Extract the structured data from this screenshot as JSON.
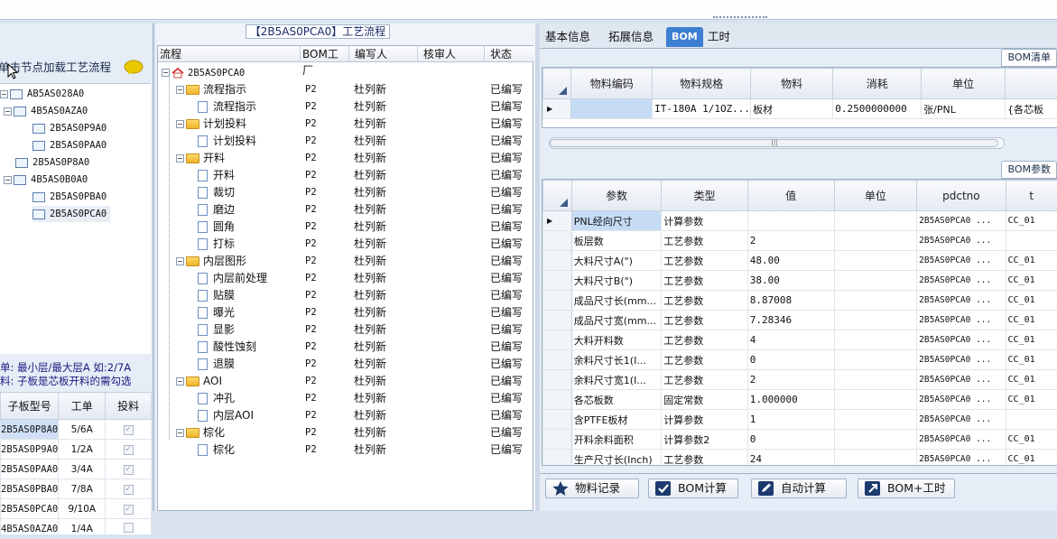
{
  "left": {
    "title": "单击节点加载工艺流程",
    "tree": [
      {
        "label": "AB5AS028A0",
        "level": 0,
        "expanded": true
      },
      {
        "label": "4B5AS0AZA0",
        "level": 1,
        "expanded": true
      },
      {
        "label": "2B5AS0P9A0",
        "level": 2
      },
      {
        "label": "2B5AS0PAA0",
        "level": 2
      },
      {
        "label": "2B5AS0P8A0",
        "level": 1
      },
      {
        "label": "4B5AS0B0A0",
        "level": 1,
        "expanded": true
      },
      {
        "label": "2B5AS0PBA0",
        "level": 2
      },
      {
        "label": "2B5AS0PCA0",
        "level": 2,
        "selected": true
      }
    ],
    "note_line1": "单: 最小层/最大层A 如:2/7A",
    "note_line2": "料: 子板是芯板开料的需勾选",
    "grid_headers": [
      "子板型号",
      "工单",
      "投料"
    ],
    "grid_rows": [
      {
        "model": "2B5AS0P8A0",
        "order": "5/6A",
        "checked": true,
        "selected": true
      },
      {
        "model": "2B5AS0P9A0",
        "order": "1/2A",
        "checked": true
      },
      {
        "model": "2B5AS0PAA0",
        "order": "3/4A",
        "checked": true
      },
      {
        "model": "2B5AS0PBA0",
        "order": "7/8A",
        "checked": true
      },
      {
        "model": "2B5AS0PCA0",
        "order": "9/10A",
        "checked": true
      },
      {
        "model": "4B5AS0AZA0",
        "order": "1/4A",
        "checked": false
      }
    ]
  },
  "middle": {
    "title": "【2B5AS0PCA0】工艺流程",
    "headers": [
      "流程",
      "BOM工厂",
      "编写人",
      "核审人",
      "状态"
    ],
    "root": "2B5AS0PCA0",
    "rows": [
      {
        "name": "流程指示",
        "type": "folder",
        "bom": "P2",
        "writer": "杜列新",
        "status": "已编写"
      },
      {
        "name": "流程指示",
        "type": "doc",
        "bom": "P2",
        "writer": "杜列新",
        "status": "已编写"
      },
      {
        "name": "计划投料",
        "type": "folder",
        "bom": "P2",
        "writer": "杜列新",
        "status": "已编写"
      },
      {
        "name": "计划投料",
        "type": "doc",
        "bom": "P2",
        "writer": "杜列新",
        "status": "已编写"
      },
      {
        "name": "开料",
        "type": "folder",
        "bom": "P2",
        "writer": "杜列新",
        "status": "已编写"
      },
      {
        "name": "开料",
        "type": "doc",
        "bom": "P2",
        "writer": "杜列新",
        "status": "已编写"
      },
      {
        "name": "裁切",
        "type": "doc",
        "bom": "P2",
        "writer": "杜列新",
        "status": "已编写"
      },
      {
        "name": "磨边",
        "type": "doc",
        "bom": "P2",
        "writer": "杜列新",
        "status": "已编写"
      },
      {
        "name": "圆角",
        "type": "doc",
        "bom": "P2",
        "writer": "杜列新",
        "status": "已编写"
      },
      {
        "name": "打标",
        "type": "doc",
        "bom": "P2",
        "writer": "杜列新",
        "status": "已编写"
      },
      {
        "name": "内层图形",
        "type": "folder",
        "bom": "P2",
        "writer": "杜列新",
        "status": "已编写"
      },
      {
        "name": "内层前处理",
        "type": "doc",
        "bom": "P2",
        "writer": "杜列新",
        "status": "已编写"
      },
      {
        "name": "贴膜",
        "type": "doc",
        "bom": "P2",
        "writer": "杜列新",
        "status": "已编写"
      },
      {
        "name": "曝光",
        "type": "doc",
        "bom": "P2",
        "writer": "杜列新",
        "status": "已编写"
      },
      {
        "name": "显影",
        "type": "doc",
        "bom": "P2",
        "writer": "杜列新",
        "status": "已编写"
      },
      {
        "name": "酸性蚀刻",
        "type": "doc",
        "bom": "P2",
        "writer": "杜列新",
        "status": "已编写"
      },
      {
        "name": "退膜",
        "type": "doc",
        "bom": "P2",
        "writer": "杜列新",
        "status": "已编写"
      },
      {
        "name": "AOI",
        "type": "folder",
        "bom": "P2",
        "writer": "杜列新",
        "status": "已编写"
      },
      {
        "name": "冲孔",
        "type": "doc",
        "bom": "P2",
        "writer": "杜列新",
        "status": "已编写"
      },
      {
        "name": "内层AOI",
        "type": "doc",
        "bom": "P2",
        "writer": "杜列新",
        "status": "已编写"
      },
      {
        "name": "棕化",
        "type": "folder",
        "bom": "P2",
        "writer": "杜列新",
        "status": "已编写"
      },
      {
        "name": "棕化",
        "type": "doc",
        "bom": "P2",
        "writer": "杜列新",
        "status": "已编写"
      }
    ]
  },
  "right": {
    "tabs": [
      "基本信息",
      "拓展信息",
      "BOM",
      "工时"
    ],
    "active_tab": "BOM",
    "bom_list_label": "BOM清单",
    "bom_headers": [
      "物料编码",
      "物料规格",
      "物料",
      "消耗",
      "单位",
      ""
    ],
    "bom_rows": [
      {
        "code": "",
        "spec": "IT-180A 1/1OZ...",
        "material": "板材",
        "consume": "0.2500000000",
        "unit": "张/PNL",
        "extra": "{各芯板"
      }
    ],
    "bom_param_label": "BOM参数",
    "param_headers": [
      "参数",
      "类型",
      "值",
      "单位",
      "pdctno",
      "t"
    ],
    "param_rows": [
      {
        "param": "PNL经向尺寸",
        "type": "计算参数",
        "value": "",
        "unit": "",
        "pdctno": "2B5AS0PCA0  ...",
        "t": "CC_01"
      },
      {
        "param": "板层数",
        "type": "工艺参数",
        "value": "2",
        "unit": "",
        "pdctno": "2B5AS0PCA0  ...",
        "t": ""
      },
      {
        "param": "大料尺寸A(\")",
        "type": "工艺参数",
        "value": "48.00",
        "unit": "",
        "pdctno": "2B5AS0PCA0  ...",
        "t": "CC_01"
      },
      {
        "param": "大料尺寸B(\")",
        "type": "工艺参数",
        "value": "38.00",
        "unit": "",
        "pdctno": "2B5AS0PCA0  ...",
        "t": "CC_01"
      },
      {
        "param": "成品尺寸长(mm...",
        "type": "工艺参数",
        "value": "8.87008",
        "unit": "",
        "pdctno": "2B5AS0PCA0  ...",
        "t": "CC_01"
      },
      {
        "param": "成品尺寸宽(mm...",
        "type": "工艺参数",
        "value": "7.28346",
        "unit": "",
        "pdctno": "2B5AS0PCA0  ...",
        "t": "CC_01"
      },
      {
        "param": "大料开料数",
        "type": "工艺参数",
        "value": "4",
        "unit": "",
        "pdctno": "2B5AS0PCA0  ...",
        "t": "CC_01"
      },
      {
        "param": "余料尺寸长1(I...",
        "type": "工艺参数",
        "value": "0",
        "unit": "",
        "pdctno": "2B5AS0PCA0  ...",
        "t": "CC_01"
      },
      {
        "param": "余料尺寸宽1(I...",
        "type": "工艺参数",
        "value": "2",
        "unit": "",
        "pdctno": "2B5AS0PCA0  ...",
        "t": "CC_01"
      },
      {
        "param": "各芯板数",
        "type": "固定常数",
        "value": "1.000000",
        "unit": "",
        "pdctno": "2B5AS0PCA0  ...",
        "t": "CC_01"
      },
      {
        "param": "含PTFE板材",
        "type": "计算参数",
        "value": "1",
        "unit": "",
        "pdctno": "2B5AS0PCA0  ...",
        "t": ""
      },
      {
        "param": "开料余料面积",
        "type": "计算参数2",
        "value": "0",
        "unit": "",
        "pdctno": "2B5AS0PCA0  ...",
        "t": "CC_01"
      },
      {
        "param": "生产尺寸长(Inch)",
        "type": "工艺参数",
        "value": "24",
        "unit": "",
        "pdctno": "2B5AS0PCA0  ...",
        "t": "CC_01"
      }
    ],
    "buttons": [
      "物料记录",
      "BOM计算",
      "自动计算",
      "BOM+工时"
    ]
  }
}
